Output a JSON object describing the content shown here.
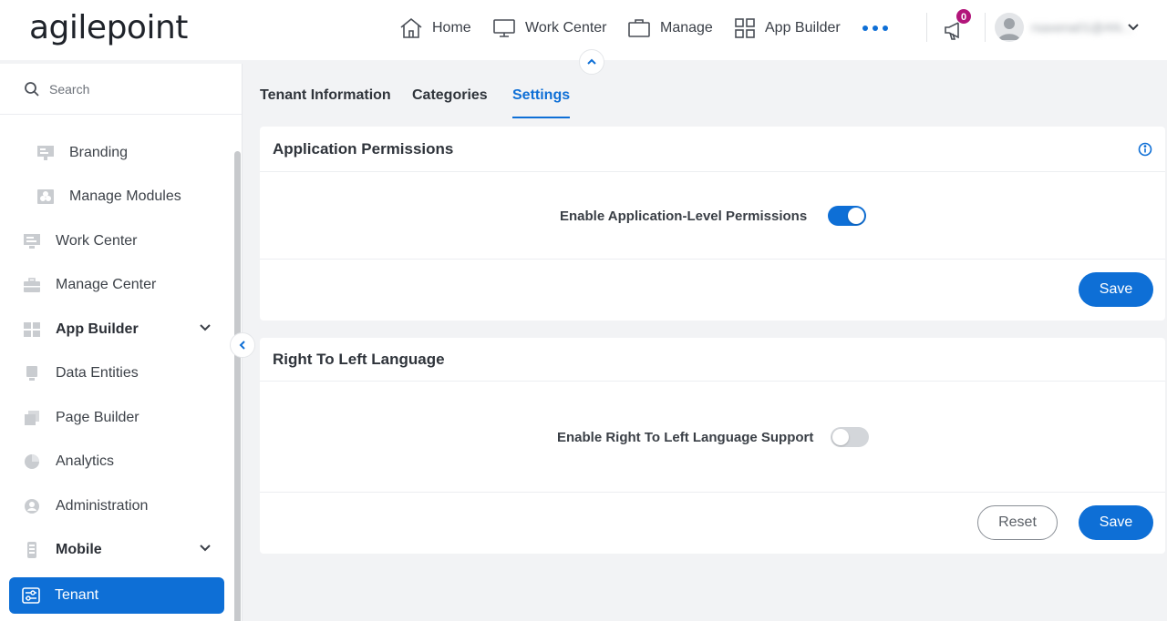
{
  "app": {
    "logo_text": "agilepoint"
  },
  "topnav": {
    "items": [
      {
        "label": "Home",
        "icon": "home-icon"
      },
      {
        "label": "Work Center",
        "icon": "monitor-icon"
      },
      {
        "label": "Manage",
        "icon": "briefcase-icon"
      },
      {
        "label": "App Builder",
        "icon": "grid-icon"
      }
    ],
    "more_icon": "more-horizontal-icon",
    "notifications_count": "0",
    "user_name": "rsaxena01@AN...",
    "accent_color": "#0e6fd6",
    "badge_color": "#b2157a"
  },
  "sidebar": {
    "search_placeholder": "Search",
    "items": [
      {
        "label": "Branding",
        "icon": "branding-icon",
        "indent": true
      },
      {
        "label": "Manage Modules",
        "icon": "modules-icon",
        "indent": true
      },
      {
        "label": "Work Center",
        "icon": "monitor-icon"
      },
      {
        "label": "Manage Center",
        "icon": "briefcase-icon"
      },
      {
        "label": "App Builder",
        "icon": "grid-icon",
        "expandable": true
      },
      {
        "label": "Data Entities",
        "icon": "data-entities-icon"
      },
      {
        "label": "Page Builder",
        "icon": "page-builder-icon"
      },
      {
        "label": "Analytics",
        "icon": "pie-chart-icon"
      },
      {
        "label": "Administration",
        "icon": "admin-icon"
      },
      {
        "label": "Mobile",
        "icon": "mobile-icon",
        "expandable": true
      },
      {
        "label": "Tenant",
        "icon": "tenant-sliders-icon",
        "active": true
      }
    ]
  },
  "tabs": [
    {
      "label": "Tenant Information"
    },
    {
      "label": "Categories"
    },
    {
      "label": "Settings",
      "active": true
    }
  ],
  "sections": {
    "app_permissions": {
      "title": "Application Permissions",
      "setting_label": "Enable Application-Level Permissions",
      "enabled": true,
      "save_label": "Save"
    },
    "rtl": {
      "title": "Right To Left Language",
      "setting_label": "Enable Right To Left Language Support",
      "enabled": false,
      "reset_label": "Reset",
      "save_label": "Save"
    }
  }
}
